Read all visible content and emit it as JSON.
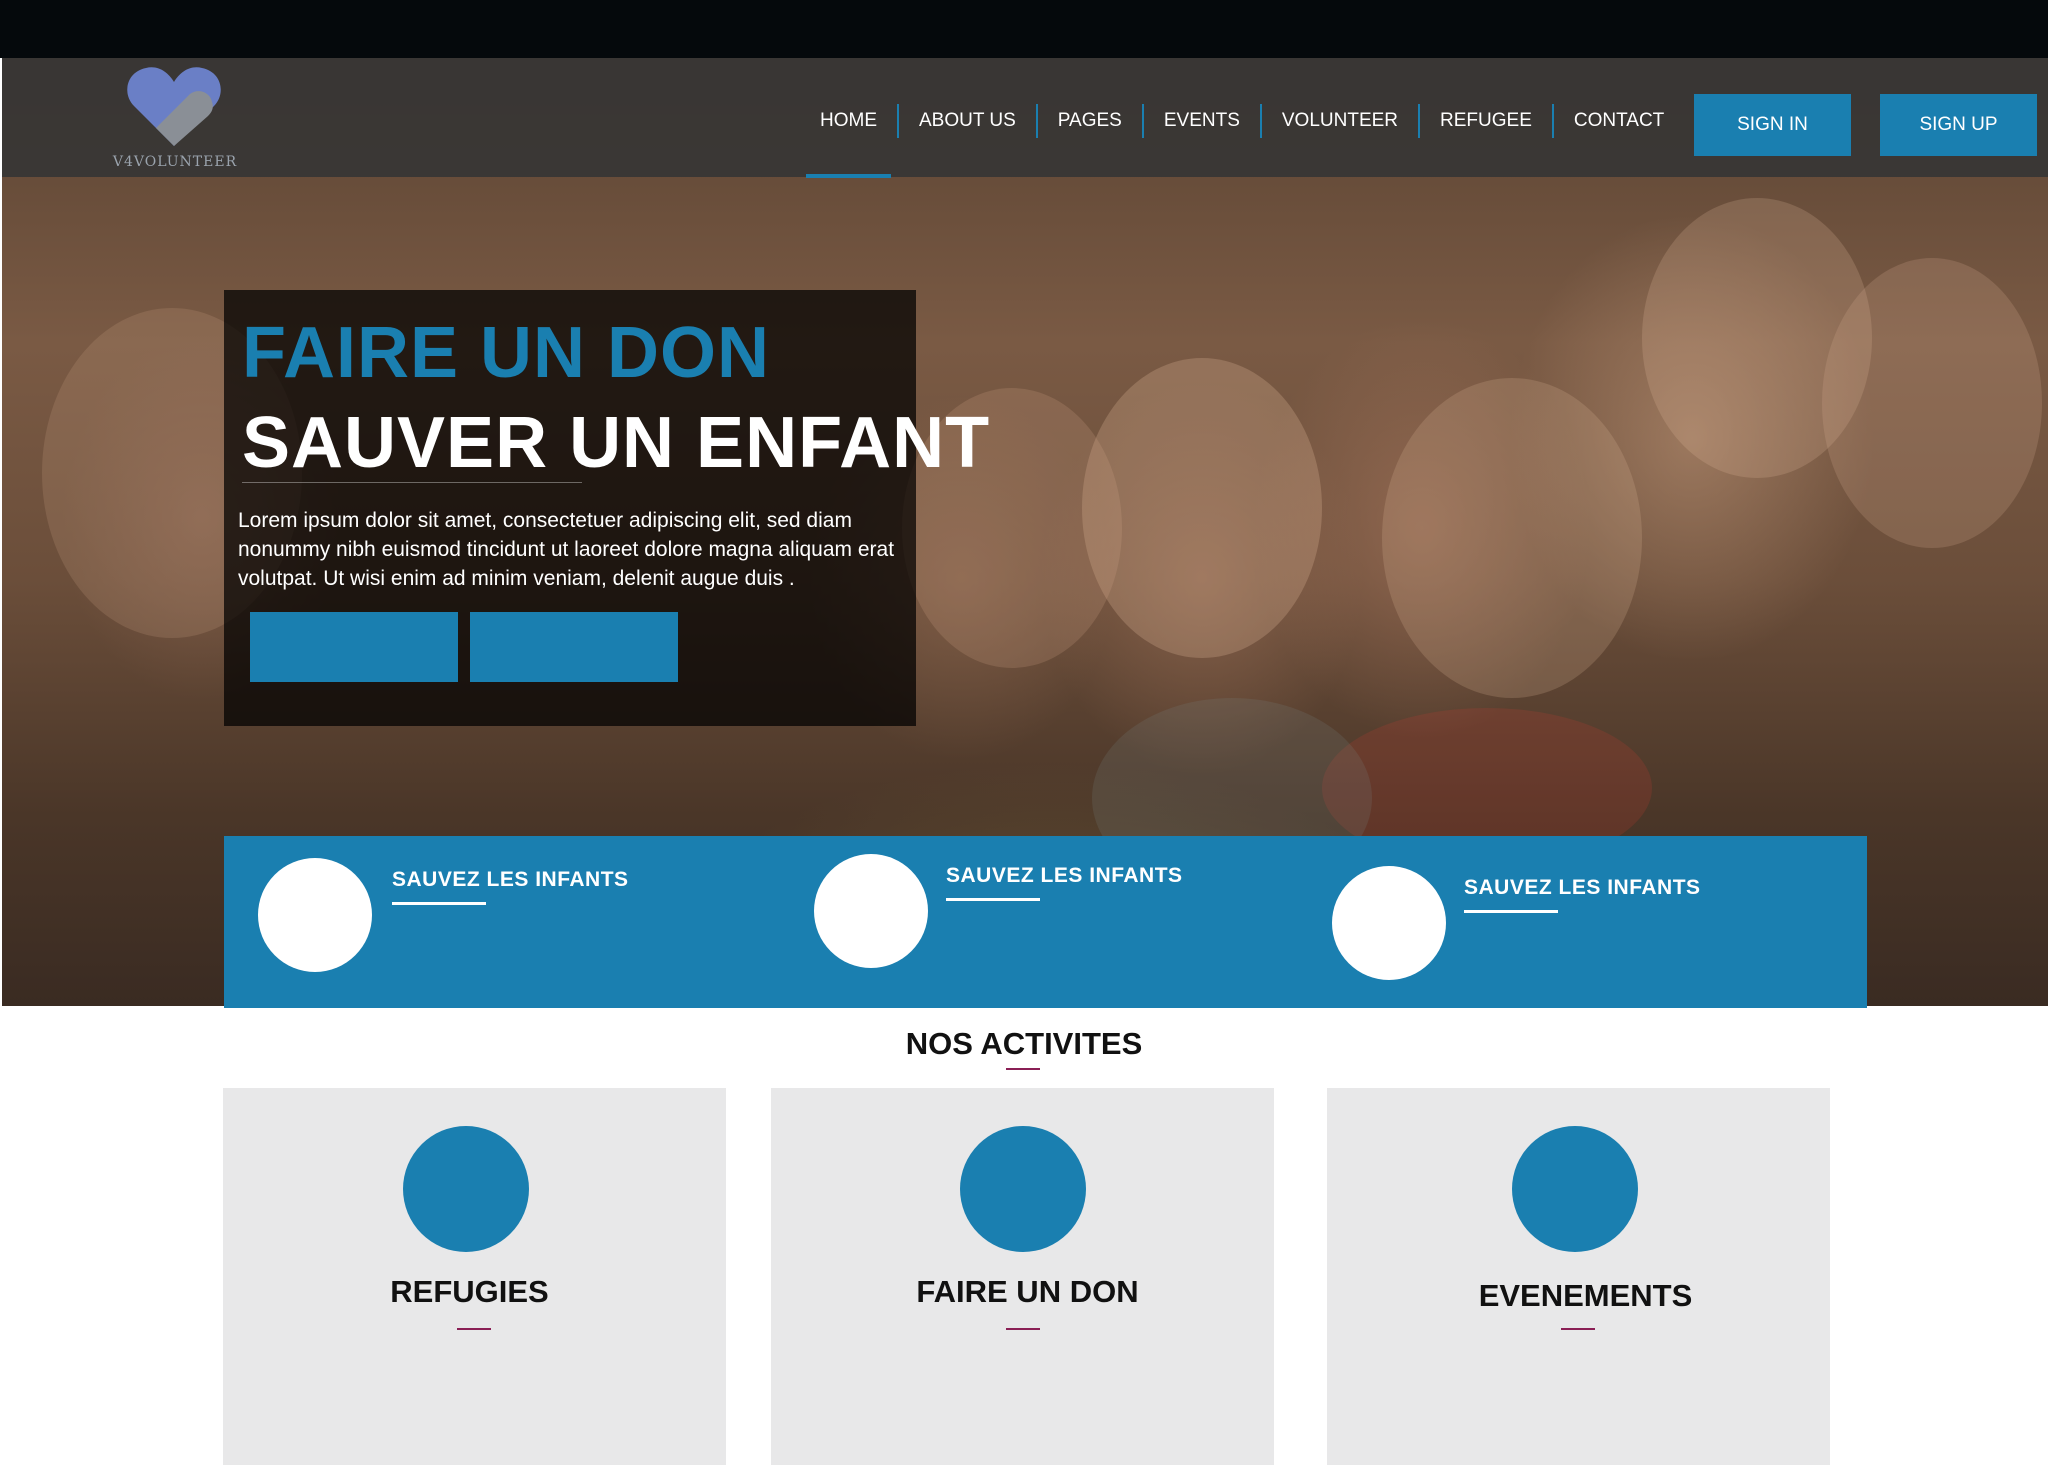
{
  "logo": {
    "name": "V4VOLUNTEER",
    "icon": "heart-icon"
  },
  "nav": {
    "items": [
      {
        "label": "HOME",
        "active": true
      },
      {
        "label": "ABOUT US"
      },
      {
        "label": "PAGES"
      },
      {
        "label": "EVENTS"
      },
      {
        "label": "VOLUNTEER"
      },
      {
        "label": "REFUGEE"
      },
      {
        "label": "CONTACT"
      }
    ],
    "sign_in": "SIGN IN",
    "sign_up": "SIGN UP"
  },
  "hero": {
    "title1": "FAIRE UN DON",
    "title2": "SAUVER UN ENFANT",
    "text": "Lorem ipsum dolor sit amet, consectetuer adipiscing elit, sed diam nonummy nibh euismod tincidunt ut laoreet dolore magna aliquam erat volutpat. Ut wisi enim ad minim veniam, delenit augue duis ."
  },
  "features": [
    {
      "title": "SAUVEZ LES INFANTS"
    },
    {
      "title": "SAUVEZ LES INFANTS"
    },
    {
      "title": "SAUVEZ LES INFANTS"
    }
  ],
  "activities": {
    "title": "NOS ACTIVITES",
    "cards": [
      {
        "title": "REFUGIES"
      },
      {
        "title": "FAIRE UN DON"
      },
      {
        "title": "EVENEMENTS"
      }
    ]
  },
  "colors": {
    "accent": "#1a7fb0",
    "nav_bg": "#343434",
    "card_bg": "#e8e8e9",
    "underline": "#8a1f55"
  }
}
